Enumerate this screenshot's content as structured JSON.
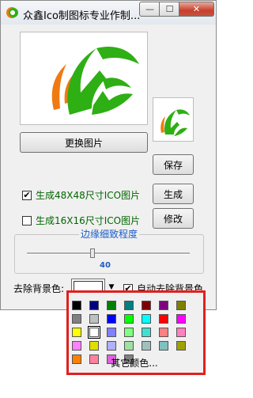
{
  "window": {
    "title": "众鑫Ico制图标专业作制...",
    "min_glyph": "—",
    "max_glyph": "☐",
    "close_glyph": "✕"
  },
  "buttons": {
    "replace_image": "更换图片",
    "save": "保存",
    "generate": "生成",
    "modify": "修改"
  },
  "options": {
    "gen48": {
      "label": "生成48X48尺寸ICO图片",
      "checked": true
    },
    "gen16": {
      "label": "生成16X16尺寸ICO图片",
      "checked": false
    }
  },
  "edge_detail": {
    "title": "边缘细致程度",
    "value": "40"
  },
  "background": {
    "label": "去除背景色:",
    "selected_color": "#ffffff",
    "auto_label": "自动去除背景色",
    "auto_checked": true
  },
  "palette": {
    "more_colors": "其它颜色...",
    "rows": [
      [
        "#000000",
        "#000080",
        "#008000",
        "#008080",
        "#800000",
        "#800080",
        "#808000"
      ],
      [
        "#808080",
        "#c0c0c0",
        "#0000ff",
        "#00ff00",
        "#00ffff",
        "#ff0000",
        "#ff00ff"
      ],
      [
        "#ffff00",
        "#ffffff",
        "#8080ff",
        "#80ff80",
        "#40e0d0",
        "#ff8080",
        "#ff80c0"
      ],
      [
        "#ff80ff",
        "#e0e000",
        "#b0b0ff",
        "#a0e0a0",
        "#a0c0c0",
        "#80c0c0",
        "#a0a000"
      ],
      [
        "#ff8000",
        "#ff80a0",
        "#e060e0",
        "#808080"
      ]
    ]
  },
  "colors": {
    "accent_blue": "#1c5cc8",
    "label_green": "#006600",
    "highlight_red": "#e0201e",
    "logo_green": "#2eaf14",
    "logo_orange": "#f07a12"
  }
}
